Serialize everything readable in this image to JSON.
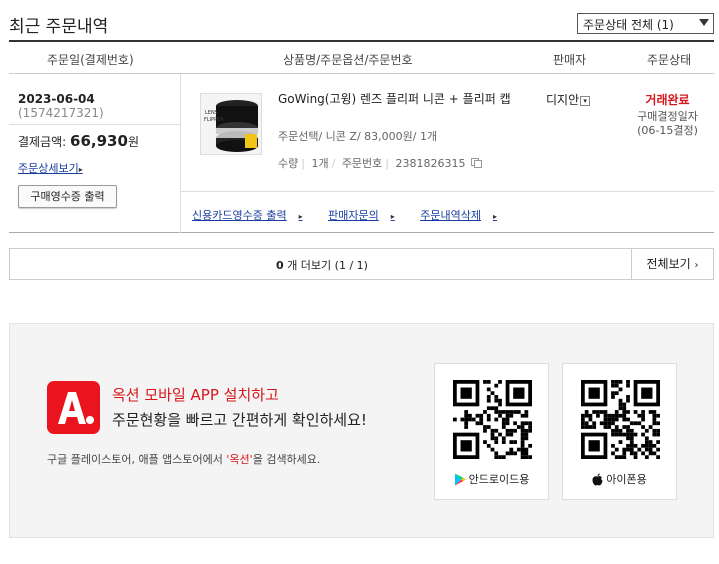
{
  "header": {
    "title": "최근 주문내역",
    "status_filter": "주문상태 전체 (1)"
  },
  "table_head": {
    "col_date": "주문일(결제번호)",
    "col_product": "상품명/주문옵션/주문번호",
    "col_seller": "판매자",
    "col_status": "주문상태"
  },
  "order": {
    "date": "2023-06-04",
    "payment_no": "(1574217321)",
    "pay_label": "결제금액:",
    "pay_amount": "66,930",
    "pay_unit": "원",
    "detail_link": "주문상세보기",
    "receipt_button": "구매영수증 출력",
    "product_name": "GoWing(고윙) 렌즈 플리퍼 니콘 + 플리퍼 캡",
    "product_option": "주문선택/ 니콘 Z/ 83,000원/ 1개",
    "qty_label": "수량",
    "qty_value": "1개",
    "order_no_label": "주문번호",
    "order_no": "2381826315",
    "seller": "디지안",
    "status": "거래완료",
    "status_sub1": "구매결정일자",
    "status_sub2": "(06-15결정)",
    "links": [
      "신용카드영수증 출력",
      "판매자문의",
      "주문내역삭제"
    ],
    "thumb_text1": "LENS",
    "thumb_text2": "FLIPPER"
  },
  "pager": {
    "count": "0",
    "more_label": "개 더보기 (1 / 1)",
    "view_all": "전체보기"
  },
  "promo": {
    "title": "옥션 모바일 APP 설치하고",
    "subtitle": "주문현황을 빠르고 간편하게 확인하세요!",
    "note_before": "구글 플레이스토어, 애플 앱스토어에서 ",
    "note_highlight": "'옥션'",
    "note_after": "을 검색하세요.",
    "android_label": "안드로이드용",
    "ios_label": "아이폰용"
  },
  "colors": {
    "accent_red": "#d8161c",
    "link_blue": "#1a3ea0"
  }
}
